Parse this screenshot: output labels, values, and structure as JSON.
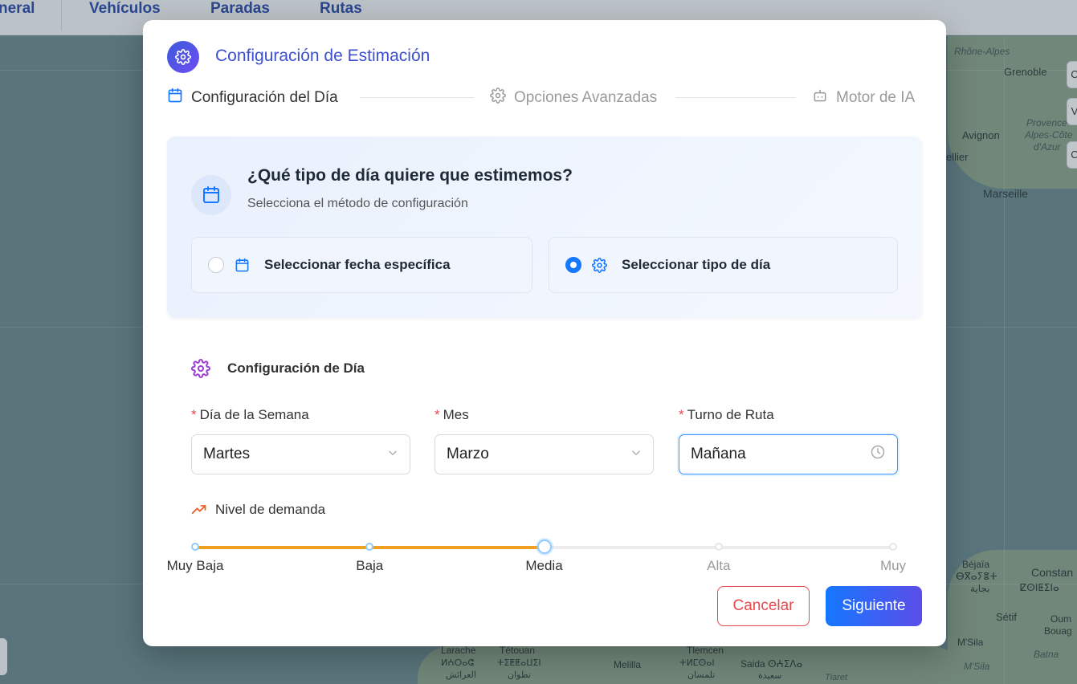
{
  "background": {
    "nav_tabs": [
      "neral",
      "Vehículos",
      "Paradas",
      "Rutas"
    ],
    "map_labels": {
      "rhone_alpes": "Rhône-Alpes",
      "grenoble": "Grenoble",
      "avignon": "Avignon",
      "provence": "Provence",
      "alpes_cote": "Alpes-Côte",
      "dazur": "d'Azur",
      "marseille": "Marseille",
      "ellier": "ellier",
      "bejaia": "Béjaïa",
      "bejaia_ar": "ⴱⴳⴰⵢⴻⵜ",
      "bejaia_ar2": "بجاية",
      "constantine": "Constan",
      "constantine_ber": "ⵇⵙⵏⵟⵉⵏⴰ",
      "setif": "Sétif",
      "oum": "Oum",
      "bouag": "Bouag",
      "msila": "M'Sila",
      "msila2": "M'Sila",
      "batna": "Batna",
      "larache": "Larache",
      "larache_ber": "ⵍⵄⵔⴰⵛ",
      "larache_ar": "العرائش",
      "tetouan": "Tétouan",
      "tetouan_ber": "ⵜⵉⵟⵟⴰⵡⵉⵏ",
      "tetouan_ar": "تطوان",
      "melilla": "Melilla",
      "tlemcen": "Tlemcen",
      "tlemcen_ber": "ⵜⵍⵎⵙⴰⵏ",
      "tlemcen_ar": "تلمسان",
      "saida": "Saida ⵙⵄⵉⴷⴰ",
      "saida_ar": "سعيدة",
      "tiaret": "Tiaret"
    }
  },
  "modal": {
    "title": "Configuración de Estimación",
    "steps": [
      {
        "label": "Configuración del Día",
        "icon": "calendar-icon",
        "active": true
      },
      {
        "label": "Opciones Avanzadas",
        "icon": "gear-icon",
        "active": false
      },
      {
        "label": "Motor de IA",
        "icon": "robot-icon",
        "active": false
      }
    ],
    "card": {
      "title": "¿Qué tipo de día quiere que estimemos?",
      "subtitle": "Selecciona el método de configuración",
      "options": [
        {
          "label": "Seleccionar fecha específica",
          "selected": false
        },
        {
          "label": "Seleccionar tipo de día",
          "selected": true
        }
      ]
    },
    "day_config": {
      "title": "Configuración de Día",
      "fields": [
        {
          "label": "Día de la Semana",
          "value": "Martes"
        },
        {
          "label": "Mes",
          "value": "Marzo"
        },
        {
          "label": "Turno de Ruta",
          "value": "Mañana"
        }
      ],
      "required_mark": "*"
    },
    "demand": {
      "label": "Nivel de demanda",
      "marks": [
        "Muy Baja",
        "Baja",
        "Media",
        "Alta",
        "Muy"
      ],
      "selected_index": 2,
      "selected_fraction": 0.5
    },
    "buttons": {
      "cancel": "Cancelar",
      "next": "Siguiente"
    }
  },
  "colors": {
    "accent": "#1677ff",
    "title": "#3b4fd0",
    "danger": "#e5484d",
    "slider_fill": "#f0a020",
    "section_icon": "#9b3fd6",
    "trend_icon": "#e8632a"
  }
}
